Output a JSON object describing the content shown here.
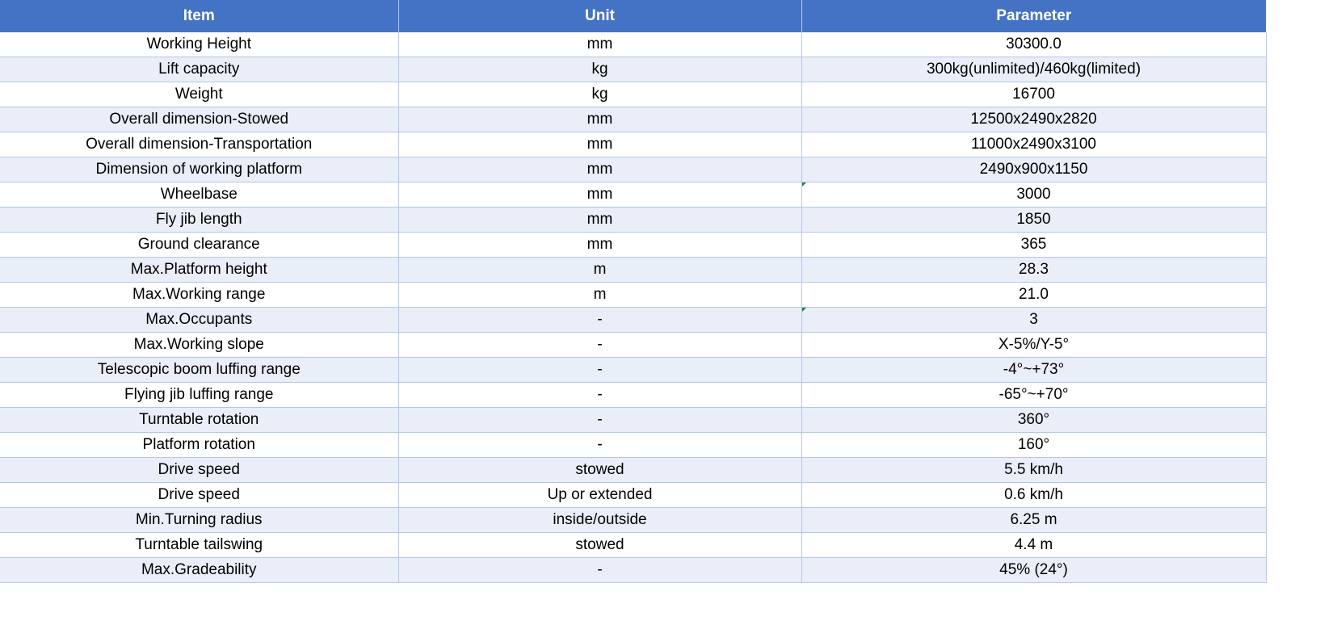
{
  "table": {
    "headers": [
      "Item",
      "Unit",
      "Parameter"
    ],
    "rows": [
      [
        "Working Height",
        "mm",
        "30300.0"
      ],
      [
        "Lift capacity",
        "kg",
        "300kg(unlimited)/460kg(limited)"
      ],
      [
        "Weight",
        "kg",
        "16700"
      ],
      [
        "Overall dimension-Stowed",
        "mm",
        "12500x2490x2820"
      ],
      [
        "Overall dimension-Transportation",
        "mm",
        "11000x2490x3100"
      ],
      [
        "Dimension of working platform",
        "mm",
        "2490x900x1150"
      ],
      [
        "Wheelbase",
        "mm",
        "3000"
      ],
      [
        "Fly jib length",
        "mm",
        "1850"
      ],
      [
        "Ground clearance",
        "mm",
        "365"
      ],
      [
        "Max.Platform height",
        "m",
        "28.3"
      ],
      [
        "Max.Working range",
        "m",
        "21.0"
      ],
      [
        "Max.Occupants",
        "-",
        "3"
      ],
      [
        "Max.Working slope",
        "-",
        "X-5%/Y-5°"
      ],
      [
        "Telescopic boom luffing range",
        "-",
        "-4°~+73°"
      ],
      [
        "Flying jib luffing range",
        "-",
        "-65°~+70°"
      ],
      [
        "Turntable rotation",
        "-",
        "360°"
      ],
      [
        "Platform rotation",
        "-",
        "160°"
      ],
      [
        "Drive speed",
        "stowed",
        "5.5 km/h"
      ],
      [
        "Drive speed",
        "Up or extended",
        "0.6 km/h"
      ],
      [
        "Min.Turning radius",
        "inside/outside",
        "6.25 m"
      ],
      [
        "Turntable tailswing",
        "stowed",
        "4.4 m"
      ],
      [
        "Max.Gradeability",
        "-",
        "45% (24°)"
      ]
    ]
  },
  "colors": {
    "header_bg": "#4472c4",
    "header_text": "#ffffff",
    "band_light": "#e9eef8",
    "grid_line": "#b4c6e7",
    "comment_marker": "#1e8a3a"
  }
}
